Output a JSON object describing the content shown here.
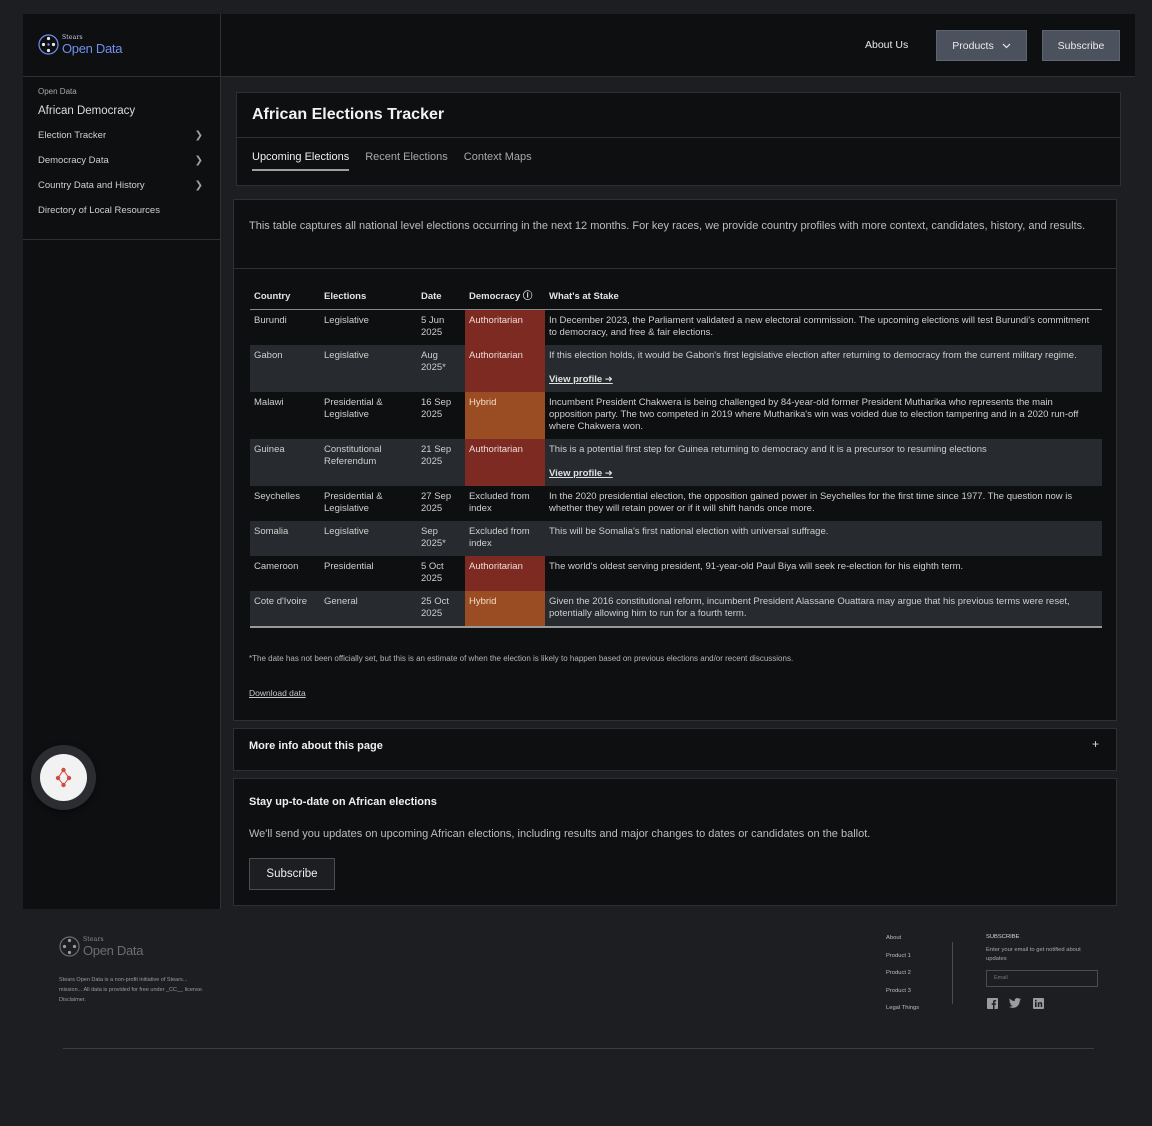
{
  "header": {
    "logo_small": "Stears",
    "logo_big": "Open Data",
    "about": "About Us",
    "products": "Products",
    "subscribe": "Subscribe"
  },
  "sidebar": {
    "crumb": "Open Data",
    "title": "African Democracy",
    "items": [
      {
        "label": "Election Tracker",
        "chevron": true
      },
      {
        "label": "Democracy Data",
        "chevron": true
      },
      {
        "label": "Country Data and History",
        "chevron": true
      },
      {
        "label": "Directory of Local Resources",
        "chevron": false
      }
    ]
  },
  "tracker": {
    "title": "African Elections Tracker",
    "tabs": [
      "Upcoming Elections",
      "Recent Elections",
      "Context Maps"
    ]
  },
  "main": {
    "intro": "This table captures all national level elections occurring in the next 12 months. For key races, we provide country profiles with more context, candidates, history, and results.",
    "columns": [
      "Country",
      "Elections",
      "Date",
      "Democracy ⓘ",
      "What's at Stake"
    ],
    "rows": [
      {
        "country": "Burundi",
        "elections": "Legislative",
        "date": "5 Jun 2025",
        "democracy": "Authoritarian",
        "stake": "In December 2023, the Parliament validated a new electoral commission. The upcoming elections will test Burundi's commitment to democracy, and free & fair elections.",
        "profile": ""
      },
      {
        "country": "Gabon",
        "elections": "Legislative",
        "date": "Aug 2025*",
        "democracy": "Authoritarian",
        "stake": "If this election holds, it would be Gabon's first legislative election after returning to democracy from the current military regime.",
        "profile": "View profile ➜"
      },
      {
        "country": "Malawi",
        "elections": "Presidential & Legislative",
        "date": "16 Sep 2025",
        "democracy": "Hybrid",
        "stake": "Incumbent President Chakwera is being challenged by 84-year-old former President Mutharika who represents the main opposition party. The two competed in 2019 where Mutharika's win was voided due to election tampering and in a 2020 run-off where Chakwera won.",
        "profile": ""
      },
      {
        "country": "Guinea",
        "elections": "Constitutional Referendum",
        "date": "21 Sep 2025",
        "democracy": "Authoritarian",
        "stake": "This is a potential first step for Guinea returning to democracy and it is a precursor to resuming elections",
        "profile": "View profile ➜"
      },
      {
        "country": "Seychelles",
        "elections": "Presidential & Legislative",
        "date": "27 Sep 2025",
        "democracy": "Excluded from index",
        "stake": "In the 2020 presidential election, the opposition gained power in Seychelles for the first time since 1977. The question now is whether they will retain power or if it will shift hands once more.",
        "profile": ""
      },
      {
        "country": "Somalia",
        "elections": "Legislative",
        "date": "Sep 2025*",
        "democracy": "Excluded from index",
        "stake": "This will be Somalia's first national election with universal suffrage.",
        "profile": ""
      },
      {
        "country": "Cameroon",
        "elections": "Presidential",
        "date": "5 Oct 2025",
        "democracy": "Authoritarian",
        "stake": "The world's oldest serving president, 91-year-old Paul Biya will seek re-election for his eighth term.",
        "profile": ""
      },
      {
        "country": "Cote d'Ivoire",
        "elections": "General",
        "date": "25 Oct 2025",
        "democracy": "Hybrid",
        "stake": "Given the 2016 constitutional reform, incumbent President Alassane Ouattara may argue that his previous terms were reset, potentially allowing him to run for a fourth term.",
        "profile": ""
      }
    ],
    "footnote": "*The date has not been officially set, but this is an estimate of when the election is likely to happen based on previous elections and/or recent discussions.",
    "download": "Download data"
  },
  "more_info": {
    "title": "More info about this page",
    "icon": "+"
  },
  "stay": {
    "title": "Stay up-to-date on African elections",
    "text": "We'll send you updates on upcoming African elections, including results and major changes to dates or candidates on the ballot.",
    "button": "Subscribe"
  },
  "footer": {
    "logo_small": "Stears",
    "logo_big": "Open Data",
    "desc": "Stears Open Data is a non-profit initiative of Stears... mission... All data is provided for free under _CC__ license. Disclaimer.",
    "links": [
      "About",
      "Product 1",
      "Product 2",
      "Product 3",
      "Legal Things"
    ],
    "subscribe_heading": "SUBSCRIBE",
    "subscribe_text": "Enter your email to get notified about updates",
    "email_placeholder": "Email"
  },
  "colors": {
    "authoritarian": "#7c2a22",
    "hybrid": "#9a4d22",
    "accent": "#6f8ff0"
  }
}
